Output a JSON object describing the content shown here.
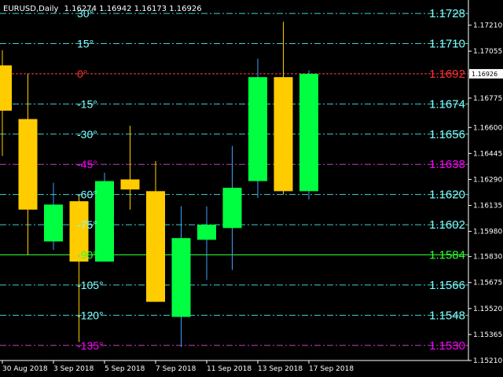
{
  "header": {
    "symbol": "EURUSD,Daily",
    "ohlc": "1.16274 1.16942 1.16173 1.16926"
  },
  "current_price_label": "1.16926",
  "colors": {
    "background": "#000000",
    "bull_body": "#00ff40",
    "bear_body": "#ffcc00",
    "bull_wick": "#3fa0ff",
    "bear_wick": "#ffcc00",
    "gann_cyan": "#7fffff",
    "gann_magenta": "#ff00ff",
    "gann_red": "#ff3030",
    "gann_green": "#30ff30",
    "level_line_cyan": "#40d0d0",
    "level_line_magenta": "#c040c0",
    "level_line_red": "#ff4040",
    "level_line_green": "#30ff30",
    "axis_text": "#ffffff"
  },
  "chart_data": {
    "type": "candlestick",
    "ylim": [
      1.1521,
      1.1736
    ],
    "price_ticks": [
      "1.17210",
      "1.17055",
      "1.16775",
      "1.16600",
      "1.16445",
      "1.16290",
      "1.16135",
      "1.15980",
      "1.15830",
      "1.15675",
      "1.15520",
      "1.15365",
      "1.15210"
    ],
    "x_tick_labels": [
      {
        "slot": 0,
        "label": "30 Aug 2018"
      },
      {
        "slot": 2,
        "label": "3 Sep 2018"
      },
      {
        "slot": 4,
        "label": "5 Sep 2018"
      },
      {
        "slot": 6,
        "label": "7 Sep 2018"
      },
      {
        "slot": 8,
        "label": "11 Sep 2018"
      },
      {
        "slot": 10,
        "label": "13 Sep 2018"
      },
      {
        "slot": 12,
        "label": "17 Sep 2018"
      }
    ],
    "candles": [
      {
        "open": 1.1697,
        "high": 1.1706,
        "low": 1.1643,
        "close": 1.167
      },
      {
        "open": 1.1665,
        "high": 1.1692,
        "low": 1.1584,
        "close": 1.1611
      },
      {
        "open": 1.1592,
        "high": 1.1627,
        "low": 1.1587,
        "close": 1.1614
      },
      {
        "open": 1.1616,
        "high": 1.1619,
        "low": 1.1532,
        "close": 1.158
      },
      {
        "open": 1.158,
        "high": 1.1633,
        "low": 1.158,
        "close": 1.1628
      },
      {
        "open": 1.1629,
        "high": 1.1661,
        "low": 1.1611,
        "close": 1.1623
      },
      {
        "open": 1.1622,
        "high": 1.164,
        "low": 1.1556,
        "close": 1.1556
      },
      {
        "open": 1.1547,
        "high": 1.1613,
        "low": 1.1529,
        "close": 1.1594
      },
      {
        "open": 1.1593,
        "high": 1.1613,
        "low": 1.1569,
        "close": 1.1602
      },
      {
        "open": 1.16,
        "high": 1.1649,
        "low": 1.1575,
        "close": 1.1624
      },
      {
        "open": 1.1628,
        "high": 1.1701,
        "low": 1.1618,
        "close": 1.169
      },
      {
        "open": 1.169,
        "high": 1.1723,
        "low": 1.162,
        "close": 1.1622
      },
      {
        "open": 1.1622,
        "high": 1.1694,
        "low": 1.1617,
        "close": 1.1692
      }
    ],
    "gann_levels": [
      {
        "angle": "30°",
        "price": "1.1728",
        "value": 1.1728,
        "color": "cyan"
      },
      {
        "angle": "15°",
        "price": "1.1710",
        "value": 1.171,
        "color": "cyan"
      },
      {
        "angle": "0°",
        "price": "1.1692",
        "value": 1.1692,
        "color": "red"
      },
      {
        "angle": "-15°",
        "price": "1.1674",
        "value": 1.1674,
        "color": "cyan"
      },
      {
        "angle": "-30°",
        "price": "1.1656",
        "value": 1.1656,
        "color": "cyan"
      },
      {
        "angle": "-45°",
        "price": "1.1638",
        "value": 1.1638,
        "color": "magenta"
      },
      {
        "angle": "-60°",
        "price": "1.1620",
        "value": 1.162,
        "color": "cyan"
      },
      {
        "angle": "-75°",
        "price": "1.1602",
        "value": 1.1602,
        "color": "cyan"
      },
      {
        "angle": "-90°",
        "price": "1.1584",
        "value": 1.1584,
        "color": "green"
      },
      {
        "angle": "-105°",
        "price": "1.1566",
        "value": 1.1566,
        "color": "cyan"
      },
      {
        "angle": "-120°",
        "price": "1.1548",
        "value": 1.1548,
        "color": "cyan"
      },
      {
        "angle": "-135°",
        "price": "1.1530",
        "value": 1.153,
        "color": "magenta"
      }
    ]
  }
}
